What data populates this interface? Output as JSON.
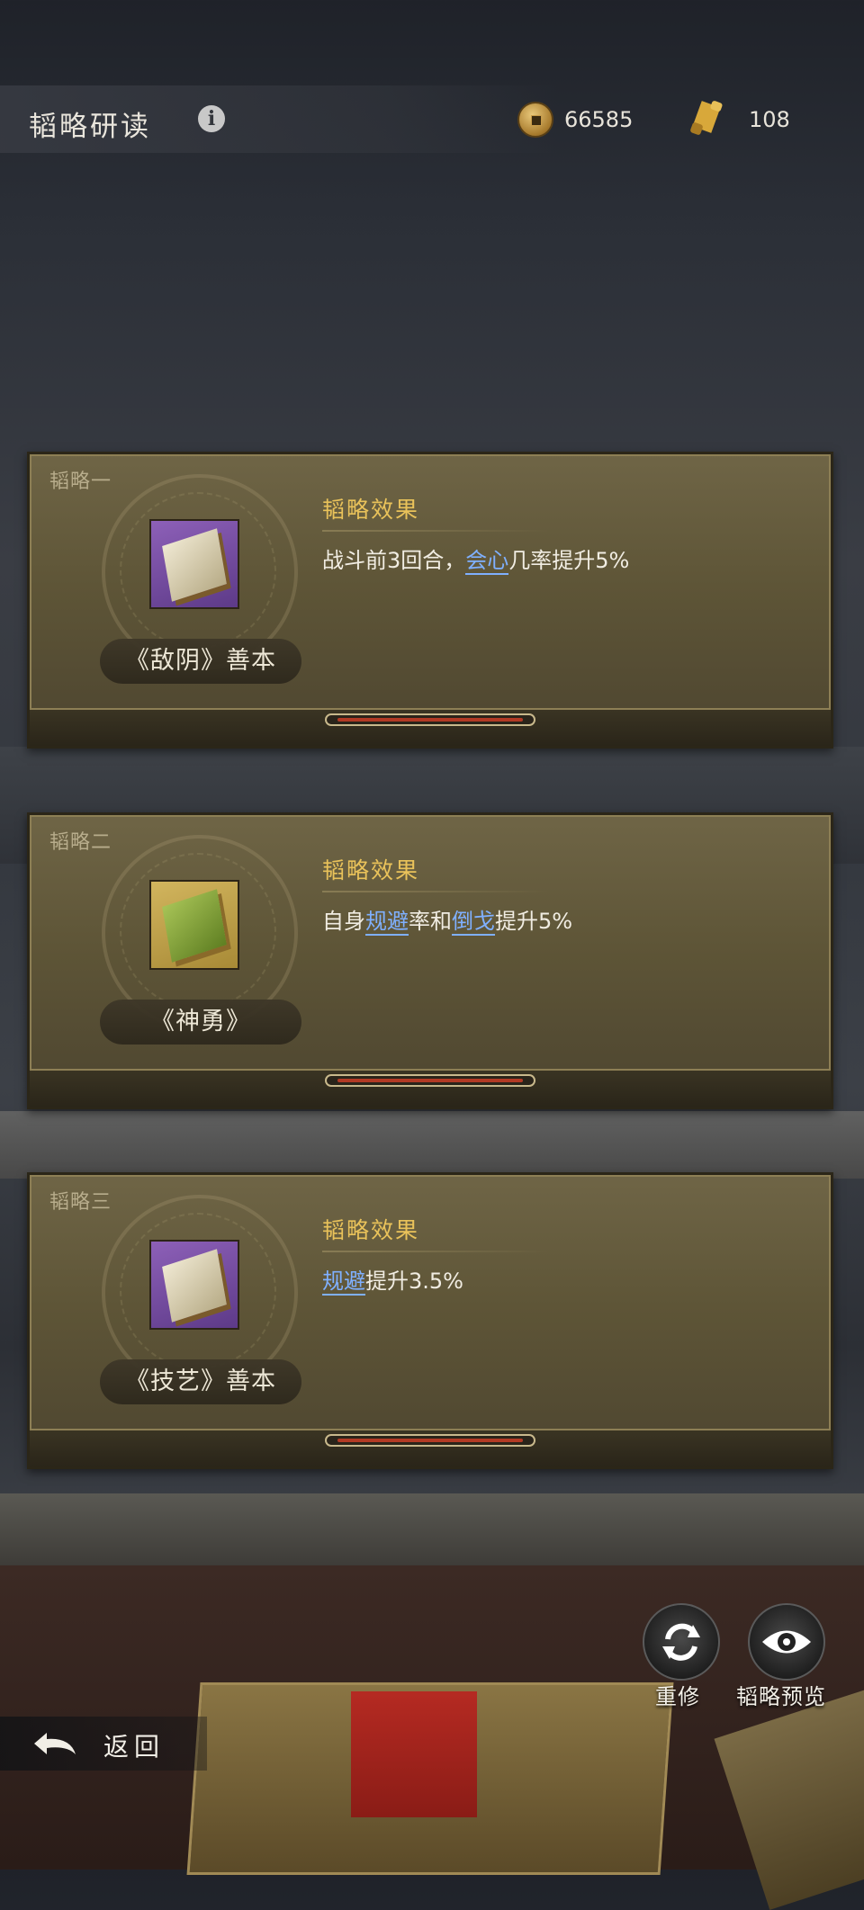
{
  "header": {
    "title": "韬略研读",
    "coins": "66585",
    "scrolls": "108"
  },
  "cards": [
    {
      "label": "韬略一",
      "book_name": "《敌阴》善本",
      "icon": "purple-book-icon",
      "effect_title": "韬略效果",
      "effect_parts": [
        "战斗前3回合，",
        "会心",
        "几率提升5%"
      ]
    },
    {
      "label": "韬略二",
      "book_name": "《神勇》",
      "icon": "gold-book-icon",
      "effect_title": "韬略效果",
      "effect_parts": [
        "自身",
        "规避",
        "率和",
        "倒戈",
        "提升5%"
      ]
    },
    {
      "label": "韬略三",
      "book_name": "《技艺》善本",
      "icon": "purple-book-icon",
      "effect_title": "韬略效果",
      "effect_parts": [
        "规避",
        "提升3.5%"
      ]
    }
  ],
  "buttons": {
    "reforge": "重修",
    "preview": "韬略预览",
    "back": "返回"
  },
  "colors": {
    "accent_gold": "#e9c25a",
    "keyword_blue": "#7fb0ff",
    "card_bg": "#5e5537",
    "progress_red": "#b23a24"
  }
}
